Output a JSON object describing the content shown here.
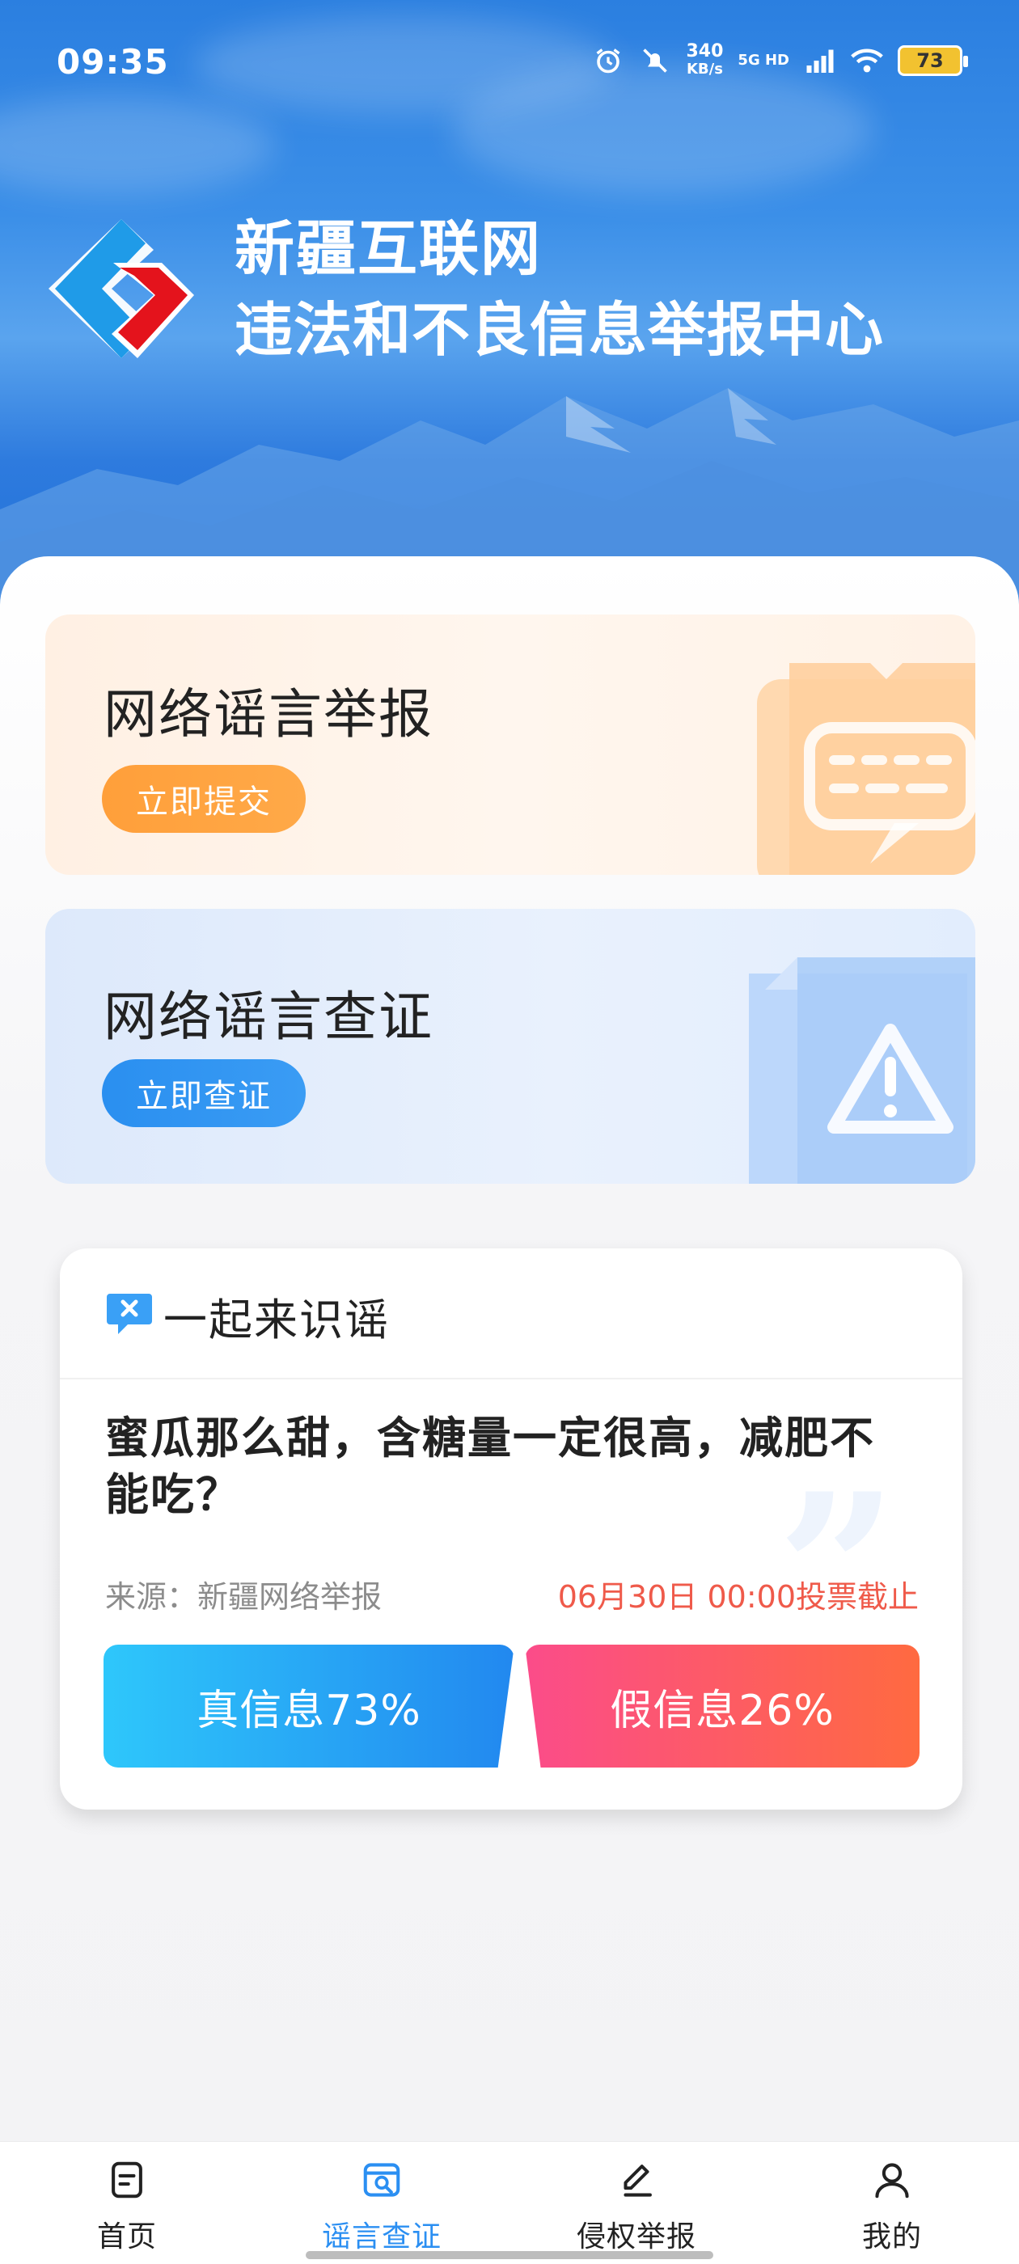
{
  "status_bar": {
    "time": "09:35",
    "speed_value": "340",
    "speed_unit": "KB/s",
    "network": "5G HD",
    "battery": "73"
  },
  "header": {
    "title": "新疆互联网",
    "subtitle": "违法和不良信息举报中心",
    "logo_icon": "xinjiang-report-logo"
  },
  "cards": [
    {
      "title": "网络谣言举报",
      "button": "立即提交",
      "icon": "chat-report-icon",
      "accent": "#ff9f3a"
    },
    {
      "title": "网络谣言查证",
      "button": "立即查证",
      "icon": "warning-document-icon",
      "accent": "#2a8ff0"
    }
  ],
  "quiz": {
    "heading": "一起来识谣",
    "question": "蜜瓜那么甜，含糖量一定很高，减肥不能吃？",
    "source": "来源：新疆网络举报",
    "deadline": "06月30日 00:00投票截止",
    "true_option": "真信息73%",
    "false_option": "假信息26%",
    "true_percent": 73,
    "false_percent": 26
  },
  "nav": {
    "items": [
      {
        "label": "首页",
        "icon": "document-icon"
      },
      {
        "label": "谣言查证",
        "icon": "search-document-icon"
      },
      {
        "label": "侵权举报",
        "icon": "edit-icon"
      },
      {
        "label": "我的",
        "icon": "user-icon"
      }
    ],
    "active_index": 1,
    "active_color": "#2b8ff2"
  }
}
